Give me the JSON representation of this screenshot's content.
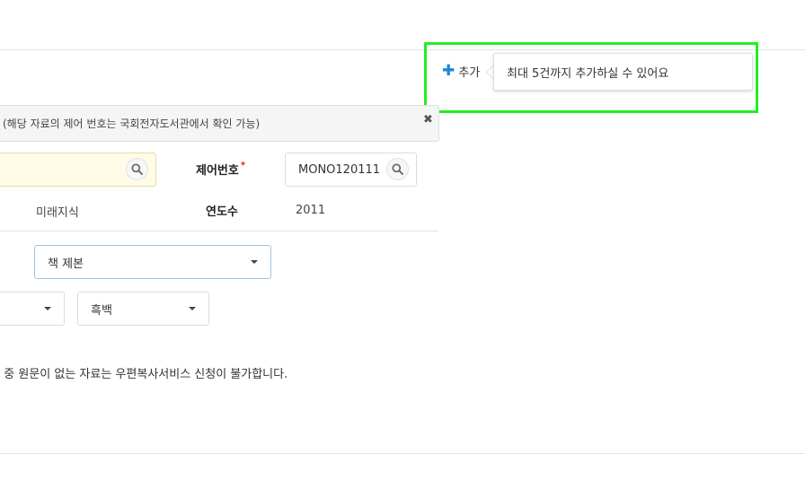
{
  "add_button": {
    "icon": "plus-icon",
    "label": "추가"
  },
  "tooltip": {
    "text": "최대 5건까지 추가하실 수 있어요"
  },
  "info_bar": {
    "text": "(해당 자료의 제어 번호는 국회전자도서관에서 확인 가능)",
    "close_icon": "close-icon"
  },
  "title_search": {
    "value": ""
  },
  "control_number": {
    "label": "제어번호",
    "required_mark": "*",
    "value": "MONO120111"
  },
  "publisher": {
    "value": "미래지식"
  },
  "year": {
    "label": "연도수",
    "value": "2011"
  },
  "format_select": {
    "selected": "책 제본"
  },
  "left_select": {
    "selected": ""
  },
  "color_select": {
    "selected": "흑백"
  },
  "notice": {
    "text": "· 중 원문이 없는 자료는 우편복사서비스 신청이 불가합니다."
  },
  "colors": {
    "accent": "#1e88d6",
    "highlight": "#22ee22",
    "title_input_bg": "#fffbe7",
    "required": "#e02020"
  }
}
